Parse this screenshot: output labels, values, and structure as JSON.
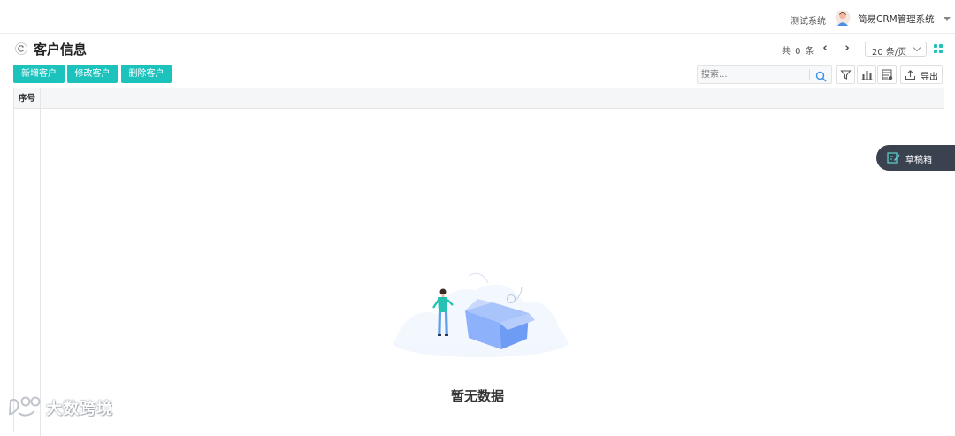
{
  "header": {
    "system_label": "测试系统",
    "app_name": "简易CRM管理系统",
    "user_menu_icon": "caret-down-icon"
  },
  "page": {
    "title": "客户信息",
    "refresh_icon": "refresh-icon"
  },
  "pagination": {
    "total_text": "共 0 条",
    "prev_icon": "chevron-left-icon",
    "next_icon": "chevron-right-icon",
    "page_size": "20 条/页",
    "view_icon": "grid-view-icon"
  },
  "toolbar": {
    "add_label": "新增客户",
    "edit_label": "修改客户",
    "delete_label": "删除客户",
    "search_placeholder": "搜索...",
    "export_label": "导出"
  },
  "table": {
    "columns": [
      "序号"
    ],
    "rows": []
  },
  "empty": {
    "text": "暂无数据"
  },
  "drafts": {
    "label": "草稿箱"
  },
  "watermark": {
    "text": "大数跨境"
  },
  "colors": {
    "primary": "#1cc3bd",
    "drafts_bg": "#3a4250",
    "illustration_blue": "#6e9cf5"
  }
}
